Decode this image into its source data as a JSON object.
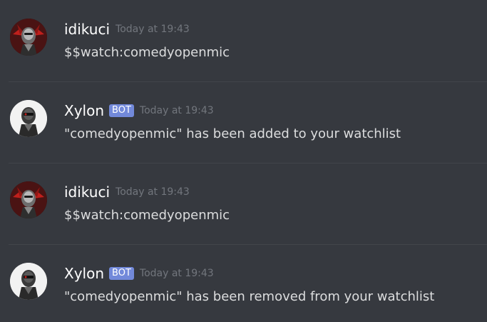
{
  "messages": [
    {
      "username": "idikuci",
      "is_bot": false,
      "timestamp": "Today at 19:43",
      "text": "$$watch:comedyopenmic",
      "avatar": "robot-red-avatar"
    },
    {
      "username": "Xylon",
      "is_bot": true,
      "bot_label": "BOT",
      "timestamp": "Today at 19:43",
      "text": "\"comedyopenmic\" has been added to your watchlist",
      "avatar": "robot-white-avatar"
    },
    {
      "username": "idikuci",
      "is_bot": false,
      "timestamp": "Today at 19:43",
      "text": "$$watch:comedyopenmic",
      "avatar": "robot-red-avatar"
    },
    {
      "username": "Xylon",
      "is_bot": true,
      "bot_label": "BOT",
      "timestamp": "Today at 19:43",
      "text": "\"comedyopenmic\" has been removed from your watchlist",
      "avatar": "robot-white-avatar"
    }
  ],
  "colors": {
    "background": "#36393f",
    "username": "#ffffff",
    "timestamp": "#72767d",
    "message_text": "#dcddde",
    "bot_tag": "#7289da",
    "divider": "#42454a"
  }
}
